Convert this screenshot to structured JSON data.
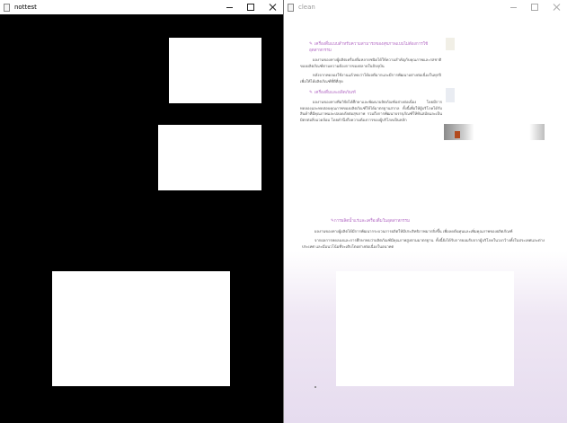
{
  "left_window": {
    "title": "nottest",
    "icon": "window-icon"
  },
  "right_window": {
    "title": "clean",
    "icon": "window-icon",
    "document": {
      "heading_1": "เครื่องดื่มแบบสำหรับความสามารถของสุขภาพแบบไม่ต้องการใช้อุตสาหกรรม",
      "para_1": "ผลงานของทางผู้ผลิตเครื่องดื่มหลายชนิดได้ให้ความสำคัญกับคุณภาพและรสชาติของผลิตภัณฑ์ตามความต้องการของตลาดในปัจจุบัน",
      "para_2": "หลังจากทดลองใช้งานแล้วพบว่าได้ผลดีมากและมีการพัฒนาอย่างต่อเนื่องในทุกปี เพื่อให้ได้ผลิตภัณฑ์ที่ดีที่สุด",
      "heading_2": "เครื่องดื่มและผลิตภัณฑ์",
      "para_3": "ผลงานของทางทีมวิจัยได้ศึกษาและพัฒนาผลิตภัณฑ์อย่างต่อเนื่อง โดยมีการทดลองและทดสอบคุณภาพของผลิตภัณฑ์ให้ได้มาตรฐานสากล ทั้งนี้เพื่อให้ผู้บริโภคได้รับสินค้าที่มีคุณภาพและปลอดภัยต่อสุขภาพ รวมถึงการพัฒนาบรรจุภัณฑ์ให้ทันสมัยและเป็นมิตรต่อสิ่งแวดล้อม โดยคำนึงถึงความต้องการของผู้บริโภคเป็นหลัก",
      "heading_3": "การผลิตน้ำแร่และเครื่องดื่มในอุตสาหกรรม",
      "para_4": "ผลงานของทางผู้ผลิตได้มีการพัฒนากระบวนการผลิตให้มีประสิทธิภาพมากยิ่งขึ้น เพื่อลดต้นทุนและเพิ่มคุณภาพของผลิตภัณฑ์",
      "para_5": "จากผลการทดลองและการศึกษาพบว่าผลิตภัณฑ์มีคุณภาพสูงตามมาตรฐาน ทั้งนี้ยังได้รับการยอมรับจากผู้บริโภคในวงกว้างทั้งในประเทศและต่างประเทศ และมีแนวโน้มที่จะเติบโตอย่างต่อเนื่องในอนาคต"
    }
  }
}
